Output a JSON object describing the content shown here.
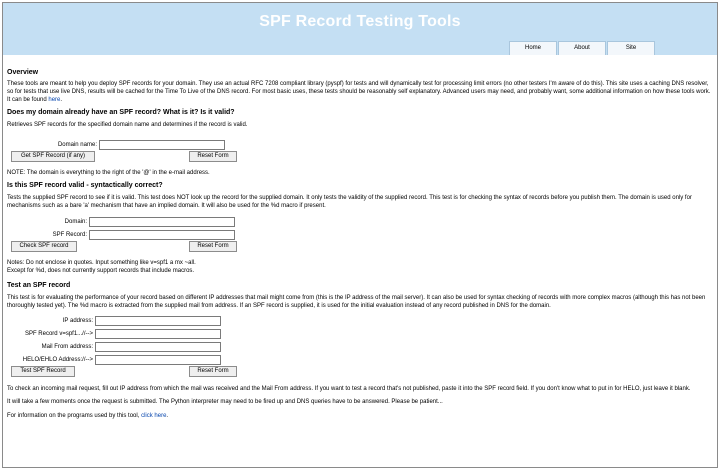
{
  "header": {
    "title": "SPF Record Testing Tools",
    "nav": [
      "Home",
      "About",
      "Site"
    ]
  },
  "overview": {
    "heading": "Overview",
    "text_before_link": "These tools are meant to help you deploy SPF records for your domain. They use an actual RFC 7208 compliant library (pyspf) for tests and will dynamically test for processing limit errors (no other testers I'm aware of do this). This site uses a caching DNS resolver, so for tests that use live DNS, results will be cached for the Time To Live of the DNS record. For most basic uses, these tests should be reasonably self explanatory. Advanced users may need, and probably want, some additional information on how these tools work. It can be found ",
    "link": "here",
    "text_after_link": "."
  },
  "section1": {
    "heading": "Does my domain already have an SPF record? What is it? Is it valid?",
    "description": "Retrieves SPF records for the specified domain name and determines if the record is valid.",
    "domain_label": "Domain name:",
    "domain_value": "",
    "submit_label": "Get SPF Record (if any)",
    "reset_label": "Reset Form",
    "note": "NOTE: The domain is everything to the right of the '@' in the e-mail address."
  },
  "section2": {
    "heading": "Is this SPF record valid - syntactically correct?",
    "description": "Tests the supplied SPF record to see if it is valid. This test does NOT look up the record for the supplied domain. It only tests the validity of the supplied record. This test is for checking the syntax of records before you publish them. The domain is used only for mechanisms such as a bare 'a' mechanism that have an implied domain. It will also be used for the %d macro if present.",
    "domain_label": "Domain:",
    "domain_value": "",
    "record_label": "SPF Record:",
    "record_value": "",
    "submit_label": "Check SPF record",
    "reset_label": "Reset Form",
    "notes_line1": "Notes: Do not enclose in quotes. Input something like v=spf1 a mx ~all.",
    "notes_line2": "Except for %d, does not currently support records that include macros."
  },
  "section3": {
    "heading": "Test an SPF record",
    "description": "This test is for evaluating the performance of your record based on different IP addresses that mail might come from (this is the IP address of the mail server). It can also be used for syntax checking of records with more complex macros (although this has not been thoroughly tested yet). The %d macro is extracted from the supplied mail from address. If an SPF record is supplied, it is used for the initial evaluation instead of any record published in DNS for the domain.",
    "ip_label": "IP address:",
    "ip_value": "",
    "record_label": "SPF Record v=spf1...//-->",
    "record_value": "",
    "mailfrom_label": "Mail From address:",
    "mailfrom_value": "",
    "helo_label": "HELO/EHLO Address://-->",
    "helo_value": "",
    "submit_label": "Test SPF Record",
    "reset_label": "Reset Form",
    "help1": "To check an incoming mail request, fill out IP address from which the mail was received and the Mail From address. If you want to test a record that's not published, paste it into the SPF record field. If you don't know what to put in for HELO, just leave it blank.",
    "help2": "It will take a few moments once the request is submitted. The Python interpreter may need to be fired up and DNS queries have to be answered. Please be patient..."
  },
  "footer": {
    "text_before_link": "For information on the programs used by this tool, ",
    "link": "click here",
    "text_after_link": "."
  }
}
